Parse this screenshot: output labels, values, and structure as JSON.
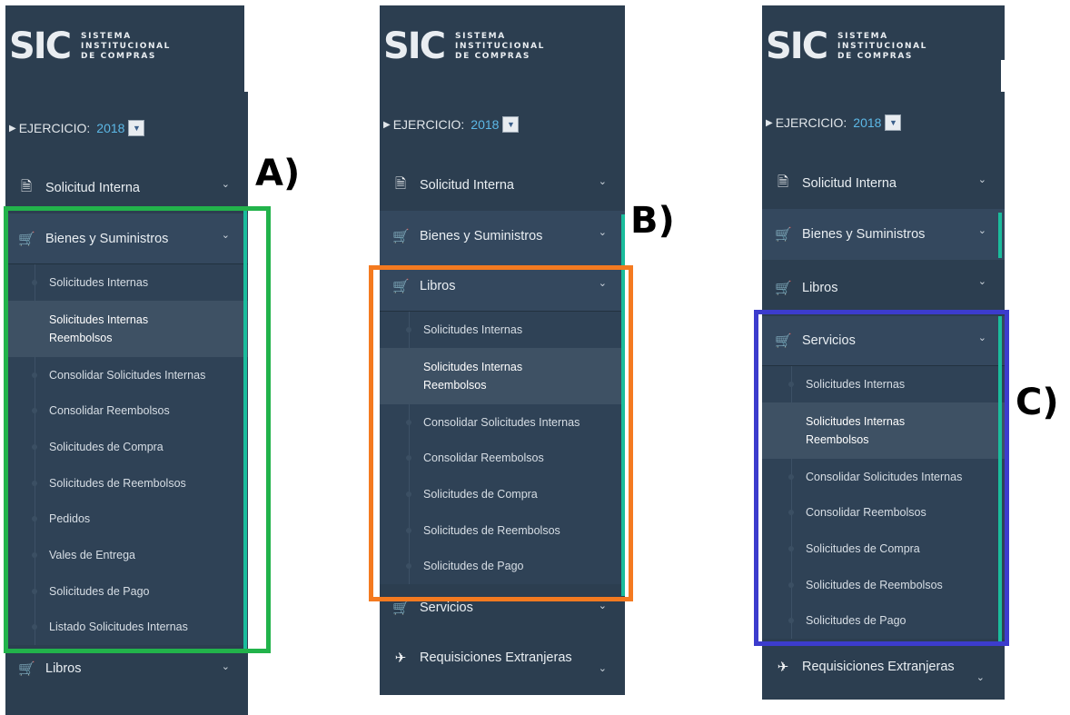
{
  "logo": {
    "mark": "SIC",
    "line1": "SISTEMA",
    "line2": "INSTITUCIONAL",
    "line3": "DE COMPRAS"
  },
  "ejercicio": {
    "label": "EJERCICIO:",
    "year": "2018"
  },
  "icons": {
    "document": "document-icon",
    "cart": "cart-icon",
    "plane": "plane-icon",
    "chevron": "chevron-down-icon"
  },
  "colors": {
    "sidebar": "#2c3e50",
    "accent": "#1abc9c",
    "year": "#5cb8e6",
    "frame_a": "#22b34b",
    "frame_b": "#f47a20",
    "frame_c": "#3c3ccd"
  },
  "panel_a": {
    "tag": "A)",
    "items": [
      "Solicitud Interna",
      "Bienes y Suministros",
      "Libros"
    ],
    "submenu": [
      "Solicitudes Internas",
      "Solicitudes Internas Reembolsos",
      "Consolidar Solicitudes Internas",
      "Consolidar Reembolsos",
      "Solicitudes de Compra",
      "Solicitudes de Reembolsos",
      "Pedidos",
      "Vales de Entrega",
      "Solicitudes de Pago",
      "Listado Solicitudes Internas"
    ]
  },
  "panel_b": {
    "tag": "B)",
    "items": [
      "Solicitud Interna",
      "Bienes y Suministros",
      "Libros",
      "Servicios",
      "Requisiciones Extranjeras"
    ],
    "submenu": [
      "Solicitudes Internas",
      "Solicitudes Internas Reembolsos",
      "Consolidar Solicitudes Internas",
      "Consolidar Reembolsos",
      "Solicitudes de Compra",
      "Solicitudes de Reembolsos",
      "Solicitudes de Pago"
    ]
  },
  "panel_c": {
    "tag": "C)",
    "items": [
      "Solicitud Interna",
      "Bienes y Suministros",
      "Libros",
      "Servicios",
      "Requisiciones Extranjeras"
    ],
    "submenu": [
      "Solicitudes Internas",
      "Solicitudes Internas Reembolsos",
      "Consolidar Solicitudes Internas",
      "Consolidar Reembolsos",
      "Solicitudes de Compra",
      "Solicitudes de Reembolsos",
      "Solicitudes de Pago"
    ]
  }
}
